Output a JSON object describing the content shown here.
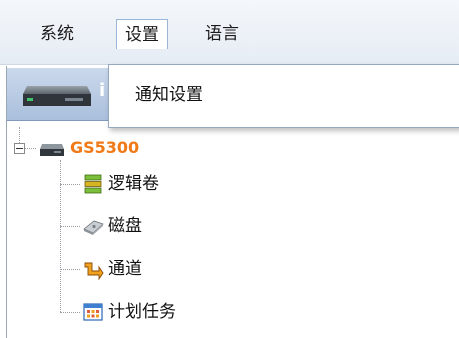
{
  "menubar": {
    "items": [
      {
        "label": "系统"
      },
      {
        "label": "设置"
      },
      {
        "label": "语言"
      }
    ]
  },
  "dropdown": {
    "items": [
      {
        "label": "通知设置"
      }
    ]
  },
  "panel": {
    "header_label": "i"
  },
  "tree": {
    "root": {
      "label": "GS5300"
    },
    "children": [
      {
        "label": "逻辑卷",
        "icon": "logical-volume-icon"
      },
      {
        "label": "磁盘",
        "icon": "disk-icon"
      },
      {
        "label": "通道",
        "icon": "channel-icon"
      },
      {
        "label": "计划任务",
        "icon": "scheduled-task-icon"
      }
    ]
  },
  "colors": {
    "root_label": "#f07a17",
    "menu_highlight_border": "#9ab6d6",
    "panel_header": "#a9bfdc"
  }
}
